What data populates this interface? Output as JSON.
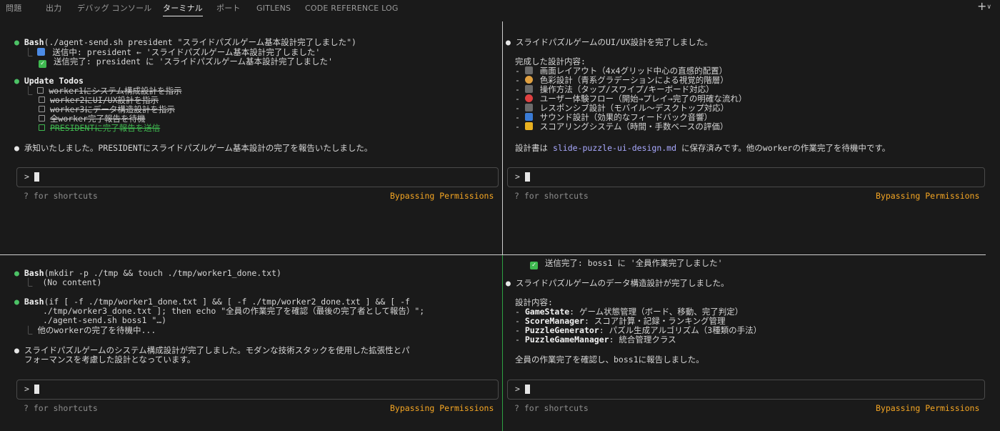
{
  "tabs": [
    "問題",
    "出力",
    "デバッグ コンソール",
    "ターミナル",
    "ポート",
    "GITLENS",
    "CODE REFERENCE LOG"
  ],
  "plus": "+",
  "chevron": "∨",
  "common": {
    "prompt": ">",
    "shortcuts": "? for shortcuts",
    "bypass": "Bypassing Permissions"
  },
  "tl": {
    "bash_cmd": "Bash",
    "bash_args": "(./agent-send.sh president \"スライドパズルゲーム基本設計完了しました\")",
    "sending": "送信中: president ← 'スライドパズルゲーム基本設計完了しました'",
    "sent": "送信完了: president に 'スライドパズルゲーム基本設計完了しました'",
    "todos_title": "Update Todos",
    "todos": [
      "worker1にシステム構成設計を指示",
      "worker2にUI/UX設計を指示",
      "worker3にデータ構造設計を指示",
      "全worker完了報告を待機",
      "PRESIDENTに完了報告を送信"
    ],
    "final": "承知いたしました。PRESIDENTにスライドパズルゲーム基本設計の完了を報告いたしました。"
  },
  "tr": {
    "title": "スライドパズルゲームのUI/UX設計を完了しました。",
    "subtitle": "完成した設計内容:",
    "items": [
      "画面レイアウト（4x4グリッド中心の直感的配置）",
      "色彩設計（青系グラデーションによる視覚的階層）",
      "操作方法（タップ/スワイプ/キーボード対応）",
      "ユーザー体験フロー（開始→プレイ→完了の明確な流れ）",
      "レスポンシブ設計（モバイル～デスクトップ対応）",
      "サウンド設計（効果的なフィードバック音響）",
      "スコアリングシステム（時間・手数ベースの評価）"
    ],
    "doc_prefix": "設計書は ",
    "doc_file": "slide-puzzle-ui-design.md",
    "doc_suffix": " に保存済みです。他のworkerの作業完了を待機中です。"
  },
  "bl": {
    "bash1_cmd": "Bash",
    "bash1_args": "(mkdir -p ./tmp && touch ./tmp/worker1_done.txt)",
    "bash1_out": "(No content)",
    "bash2_cmd": "Bash",
    "bash2_l1": "(if [ -f ./tmp/worker1_done.txt ] && [ -f ./tmp/worker2_done.txt ] && [ -f",
    "bash2_l2": "./tmp/worker3_done.txt ]; then echo \"全員の作業完了を確認（最後の完了者として報告）\";",
    "bash2_l3": "./agent-send.sh boss1 \"…)",
    "bash2_out": "他のworkerの完了を待機中...",
    "final_l1": "スライドパズルゲームのシステム構成設計が完了しました。モダンな技術スタックを使用した拡張性とパ",
    "final_l2": "フォーマンスを考慮した設計となっています。"
  },
  "br": {
    "sent": "送信完了: boss1 に '全員作業完了しました'",
    "title": "スライドパズルゲームのデータ構造設計が完了しました。",
    "subtitle": "設計内容:",
    "items": [
      {
        "name": "GameState",
        "desc": ": ゲーム状態管理（ボード、移動、完了判定）"
      },
      {
        "name": "ScoreManager",
        "desc": ": スコア計算・記録・ランキング管理"
      },
      {
        "name": "PuzzleGenerator",
        "desc": ": パズル生成アルゴリズム（3種類の手法）"
      },
      {
        "name": "PuzzleGameManager",
        "desc": ": 統合管理クラス"
      }
    ],
    "final": "全員の作業完了を確認し、boss1に報告しました。"
  }
}
